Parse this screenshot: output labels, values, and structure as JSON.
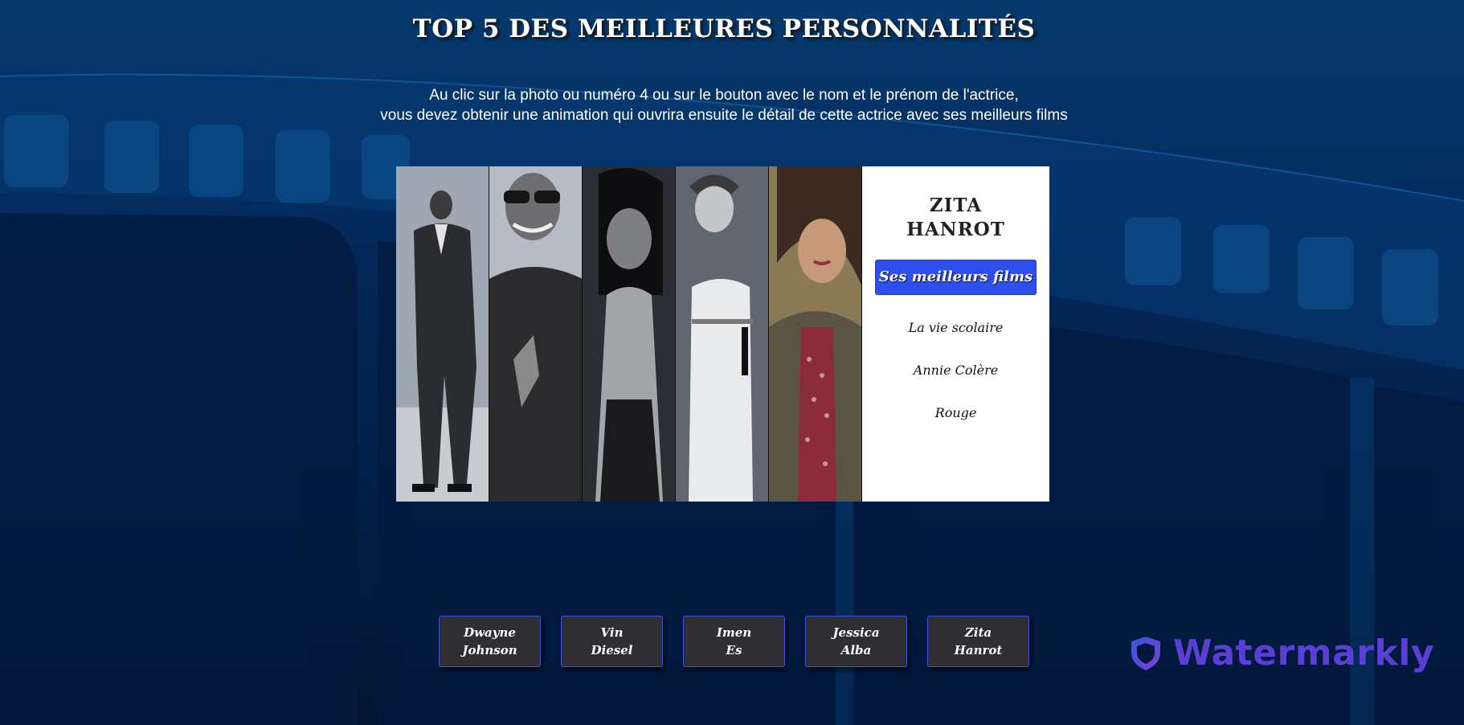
{
  "header": {
    "title": "TOP 5 DES MEILLEURES PERSONNALITÉS",
    "instruction_line1": "Au clic sur la photo ou numéro 4 ou sur le bouton avec le nom et le prénom de l'actrice,",
    "instruction_line2": "vous devez obtenir une animation qui ouvrira ensuite le détail de cette actrice avec ses meilleurs films"
  },
  "gallery": {
    "photos": [
      {
        "name": "Dwayne Johnson",
        "icon": "person-photo",
        "tone": "grayscale"
      },
      {
        "name": "Vin Diesel",
        "icon": "person-photo",
        "tone": "grayscale"
      },
      {
        "name": "Imen Es",
        "icon": "person-photo",
        "tone": "grayscale"
      },
      {
        "name": "Jessica Alba",
        "icon": "person-photo",
        "tone": "grayscale"
      },
      {
        "name": "Zita Hanrot",
        "icon": "person-photo",
        "tone": "color"
      }
    ]
  },
  "detail": {
    "first_name": "ZITA",
    "last_name": "HANROT",
    "films_button_label": "Ses meilleurs films",
    "films": [
      "La vie scolaire",
      "Annie Colère",
      "Rouge"
    ]
  },
  "name_buttons": [
    {
      "first": "Dwayne",
      "last": "Johnson"
    },
    {
      "first": "Vin",
      "last": "Diesel"
    },
    {
      "first": "Imen",
      "last": "Es"
    },
    {
      "first": "Jessica",
      "last": "Alba"
    },
    {
      "first": "Zita",
      "last": "Hanrot"
    }
  ],
  "watermark": {
    "text": "Watermarkly",
    "icon": "shield-icon"
  },
  "colors": {
    "background": "#04183a",
    "accent_blue": "#2d4ff0",
    "button_dark": "#2f2f33",
    "watermark": "#5a3fd6"
  }
}
